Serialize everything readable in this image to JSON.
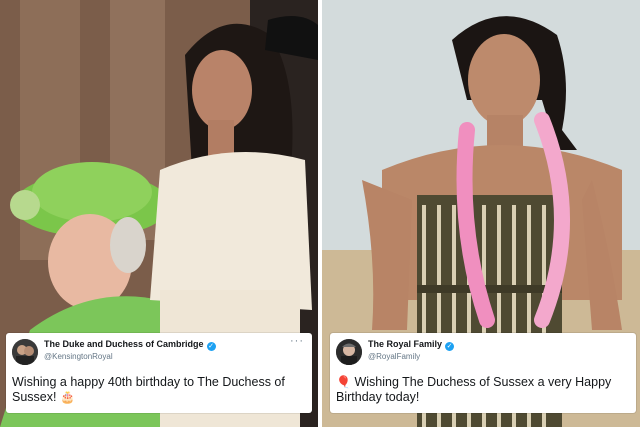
{
  "tweets": [
    {
      "display_name": "The Duke and Duchess of Cambridge",
      "handle": "@KensingtonRoyal",
      "more_icon": "···",
      "text": "Wishing a happy 40th birthday to The Duchess of Sussex!",
      "emoji": "🎂",
      "verified": true
    },
    {
      "display_name": "The Royal Family",
      "handle": "@RoyalFamily",
      "emoji": "🎈",
      "text": "Wishing The Duchess of Sussex a very Happy Birthday today!",
      "verified": true
    }
  ],
  "icons": {
    "verified": "verified-badge-icon",
    "more": "more-options-icon",
    "emoji_left": "birthday-cake-icon",
    "emoji_right": "balloon-icon"
  },
  "colors": {
    "verified_blue": "#1da1f2",
    "text_dark": "#14171a",
    "text_muted": "#657786",
    "hat_green": "#7bc64a",
    "lei_pink": "#f08fbf"
  }
}
